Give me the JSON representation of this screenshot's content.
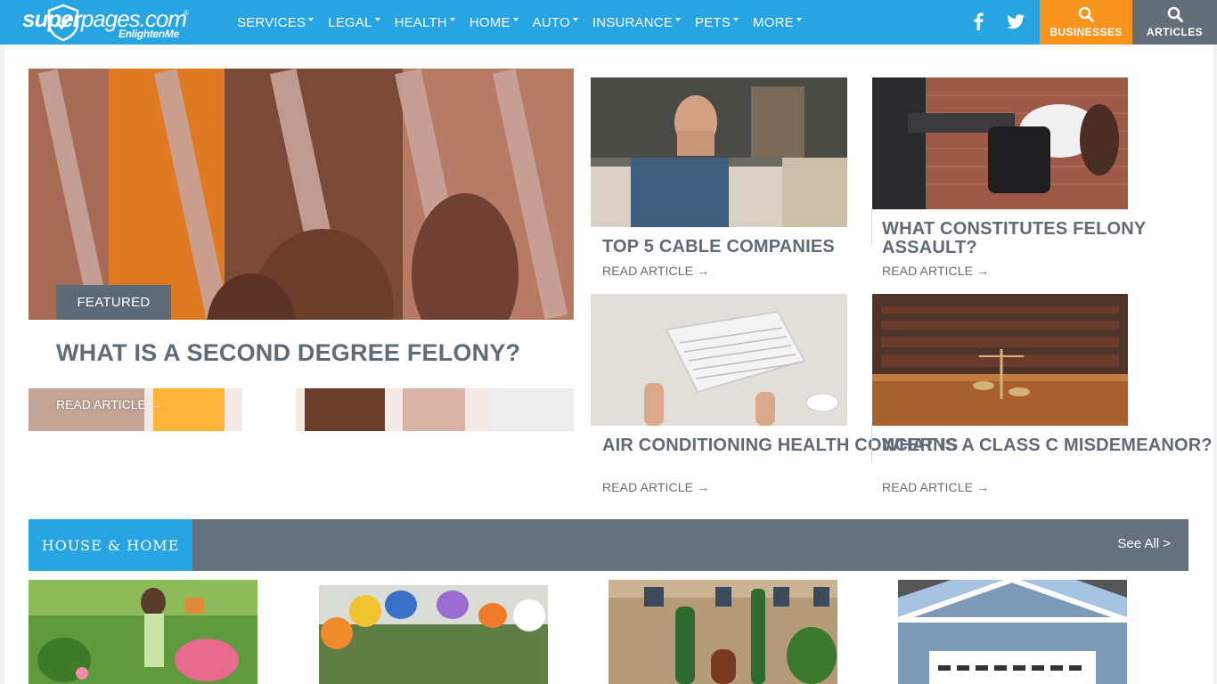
{
  "nav": {
    "logo": {
      "wordmark_a": "super",
      "wordmark_b": "pages.com",
      "registered": "®",
      "tagline": "EnlightenMe"
    },
    "menu": [
      {
        "label": "SERVICES"
      },
      {
        "label": "LEGAL"
      },
      {
        "label": "HEALTH"
      },
      {
        "label": "HOME"
      },
      {
        "label": "AUTO"
      },
      {
        "label": "INSURANCE"
      },
      {
        "label": "PETS"
      },
      {
        "label": "MORE"
      }
    ],
    "social": [
      "facebook-icon",
      "twitter-icon"
    ],
    "businesses_label": "BUSINESSES",
    "articles_label": "ARTICLES",
    "colors": {
      "nav_bg": "#27a5e2",
      "businesses_bg": "#f7941d",
      "articles_bg": "#646e79"
    }
  },
  "featured": {
    "badge": "FEATURED",
    "title": "WHAT IS A SECOND DEGREE FELONY?",
    "read": "READ ARTICLE →"
  },
  "cards": [
    {
      "title": "TOP 5 CABLE COMPANIES",
      "read": "READ ARTICLE →"
    },
    {
      "title": "WHAT CONSTITUTES FELONY ASSAULT?",
      "read": "READ ARTICLE →"
    },
    {
      "title": "AIR CONDITIONING HEALTH CONCERNS",
      "read": "READ ARTICLE →"
    },
    {
      "title": "WHAT IS A CLASS C MISDEMEANOR?",
      "read": "READ ARTICLE →"
    }
  ],
  "section": {
    "title": "HOUSE & HOME",
    "see_all": "See All >"
  }
}
